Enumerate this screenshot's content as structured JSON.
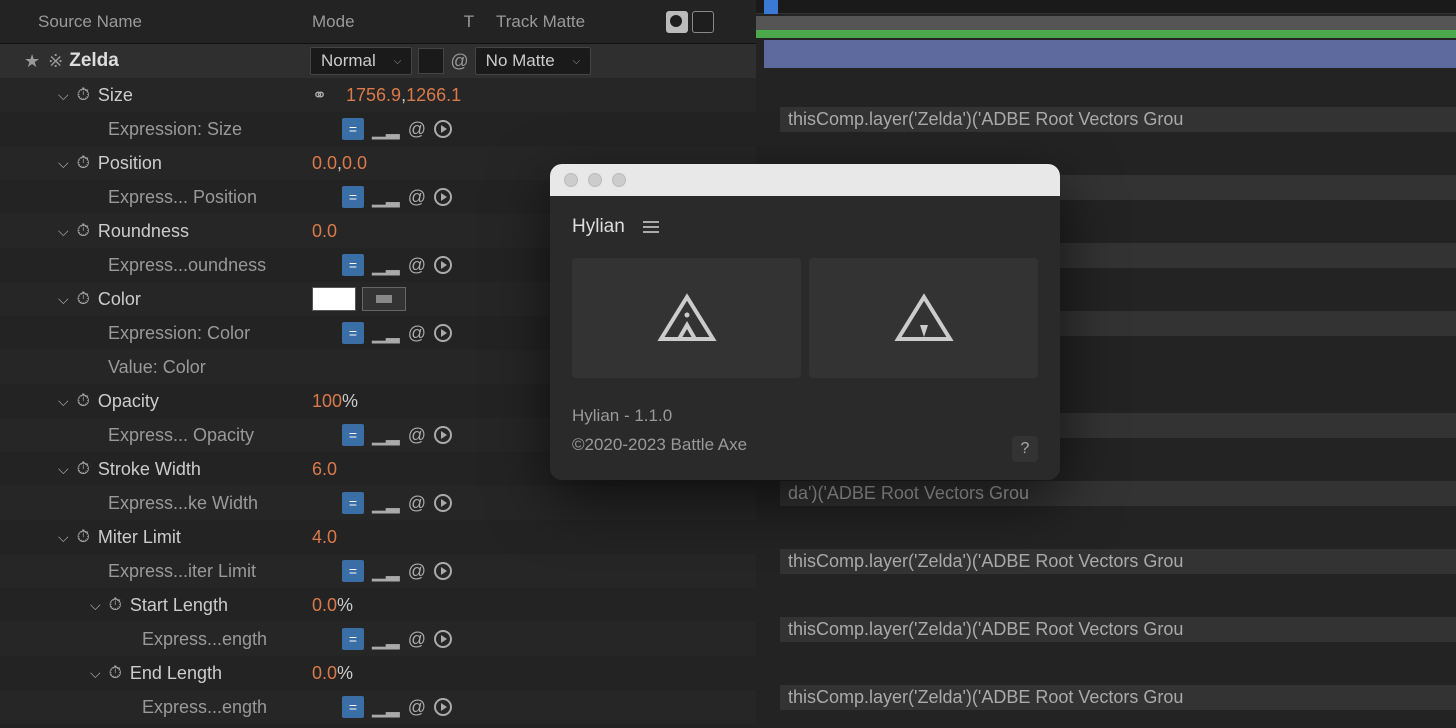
{
  "header": {
    "source_name": "Source Name",
    "mode": "Mode",
    "t": "T",
    "track_matte": "Track Matte"
  },
  "layer": {
    "name": "Zelda",
    "mode_value": "Normal",
    "matte_value": "No Matte"
  },
  "props": [
    {
      "label": "Size",
      "value": "1756.9,1266.1",
      "type": "linked",
      "indent": 1,
      "expr": "Expression: Size",
      "expr_indent": 2
    },
    {
      "label": "Position",
      "value": "0.0,0.0",
      "type": "plain",
      "indent": 1,
      "expr": "Express... Position",
      "expr_indent": 2
    },
    {
      "label": "Roundness",
      "value": "0.0",
      "type": "plain",
      "indent": 1,
      "expr": "Express...oundness",
      "expr_indent": 2
    },
    {
      "label": "Color",
      "value": "",
      "type": "color",
      "indent": 1,
      "expr": "Expression: Color",
      "expr_indent": 2,
      "extra": "Value: Color"
    },
    {
      "label": "Opacity",
      "value": "100%",
      "type": "pct",
      "indent": 1,
      "expr": "Express... Opacity",
      "expr_indent": 2
    },
    {
      "label": "Stroke Width",
      "value": "6.0",
      "type": "plain",
      "indent": 1,
      "expr": "Express...ke Width",
      "expr_indent": 2
    },
    {
      "label": "Miter Limit",
      "value": "4.0",
      "type": "plain",
      "indent": 1,
      "expr": "Express...iter Limit",
      "expr_indent": 2
    },
    {
      "label": "Start Length",
      "value": "0.0%",
      "type": "pct",
      "indent": 3,
      "expr": "Express...ength",
      "expr_indent": 4
    },
    {
      "label": "End Length",
      "value": "0.0%",
      "type": "pct",
      "indent": 3,
      "expr": "Express...ength",
      "expr_indent": 4
    }
  ],
  "timeline": {
    "expr_full": "thisComp.layer('Zelda')('ADBE Root Vectors Grou",
    "expr_cut": "da')('ADBE Root Vectors Grou"
  },
  "panel": {
    "title": "Hylian",
    "version": "Hylian - 1.1.0",
    "copyright": "©2020-2023 Battle Axe",
    "help": "?"
  }
}
